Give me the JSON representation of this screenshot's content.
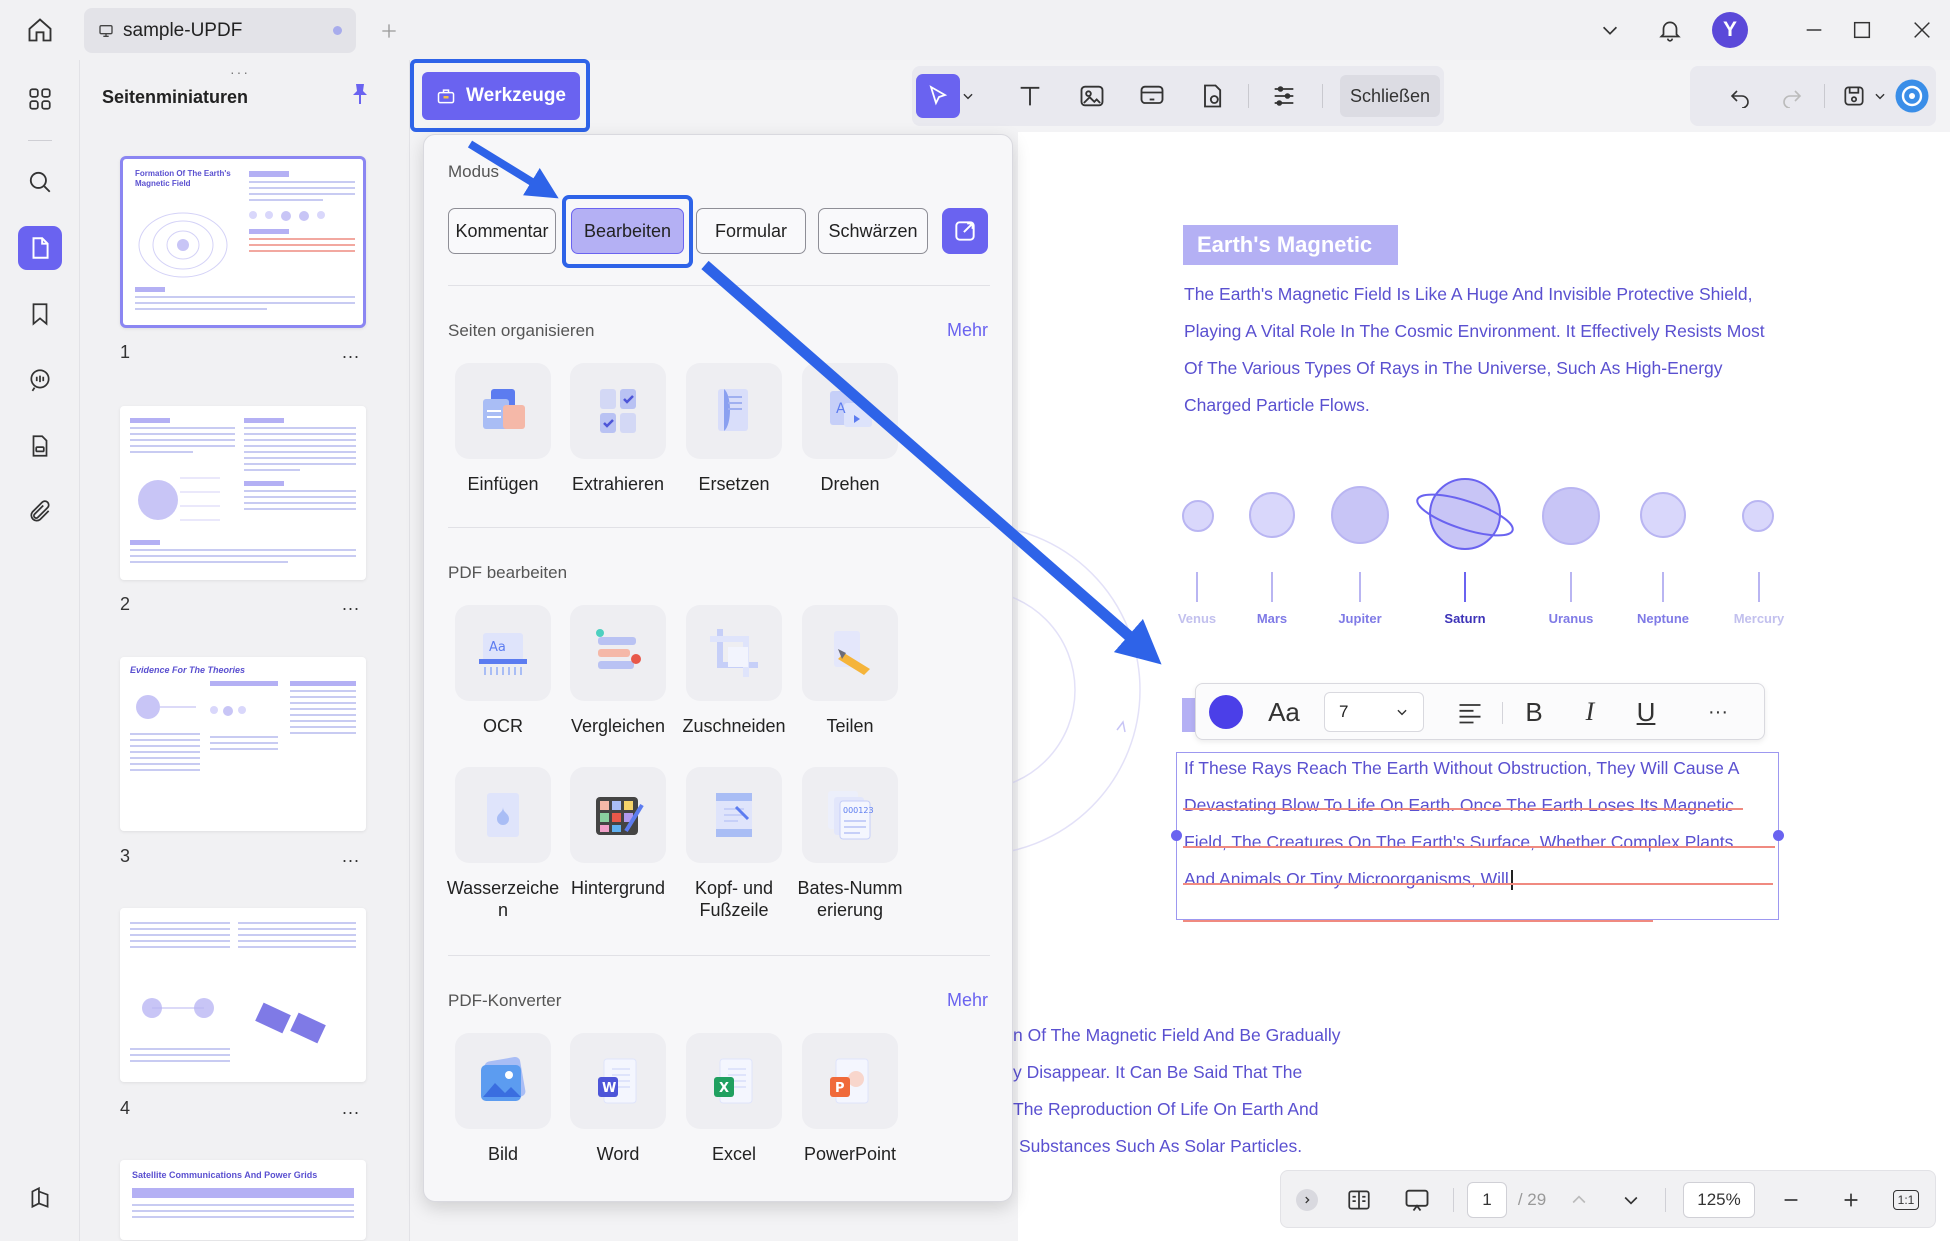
{
  "tab": {
    "title": "sample-UPDF"
  },
  "user": {
    "initial": "Y"
  },
  "thumbnails": {
    "title": "Seitenminiaturen",
    "pages": [
      {
        "num": "1",
        "title": "Formation Of The Earth's Magnetic Field"
      },
      {
        "num": "2"
      },
      {
        "num": "3",
        "title": "Evidence For The Theories"
      },
      {
        "num": "4"
      },
      {
        "num": "5",
        "title": "Satellite Communications And Power Grids"
      }
    ],
    "more": "..."
  },
  "toolbar": {
    "tools_label": "Werkzeuge",
    "close_label": "Schließen"
  },
  "dropdown": {
    "mode_label": "Modus",
    "modes": [
      "Kommentar",
      "Bearbeiten",
      "Formular",
      "Schwärzen"
    ],
    "active_mode": "Bearbeiten",
    "sections": {
      "organize": {
        "label": "Seiten organisieren",
        "more": "Mehr",
        "tools": [
          "Einfügen",
          "Extrahieren",
          "Ersetzen",
          "Drehen"
        ]
      },
      "edit": {
        "label": "PDF bearbeiten",
        "tools": [
          "OCR",
          "Vergleichen",
          "Zuschneiden",
          "Teilen",
          "Wasserzeiche n",
          "Hintergrund",
          "Kopf- und Fußzeile",
          "Bates-Numm erierung"
        ]
      },
      "convert": {
        "label": "PDF-Konverter",
        "more": "Mehr",
        "tools": [
          "Bild",
          "Word",
          "Excel",
          "PowerPoint"
        ]
      }
    }
  },
  "document": {
    "title": "Earth's Magnetic",
    "paragraph1": [
      "The Earth's Magnetic Field Is Like A Huge And Invisible Protective Shield,",
      "Playing A Vital Role In The Cosmic Environment. It Effectively Resists Most",
      "Of The Various Types Of Rays in The Universe, Such As High-Energy",
      "Charged Particle Flows."
    ],
    "planets": [
      "Venus",
      "Mars",
      "Jupiter",
      "Saturn",
      "Uranus",
      "Neptune",
      "Mercury"
    ],
    "edit_lines": [
      "If These Rays Reach The Earth Without Obstruction, They Will Cause A",
      "Devastating Blow To Life On Earth. Once The Earth Loses Its Magnetic",
      "Field, The Creatures On The Earth's Surface, Whether Complex Plants",
      "And Animals Or Tiny Microorganisms, Will"
    ],
    "paragraph3": [
      "n Of The Magnetic Field And Be Gradually",
      "y Disappear. It Can Be Said That The",
      "The Reproduction Of Life On Earth And",
      "Substances Such As Solar Particles."
    ]
  },
  "format_bar": {
    "font_size": "7",
    "font_label": "Aa",
    "bold": "B",
    "italic": "I",
    "underline": "U",
    "more": "···"
  },
  "bottom": {
    "page_current": "1",
    "page_total": "/ 29",
    "zoom": "125%",
    "fit": "1:1"
  },
  "colors": {
    "accent": "#6a63f0",
    "highlight_outline": "#2e63e8",
    "doc_text": "#5a50d0"
  }
}
